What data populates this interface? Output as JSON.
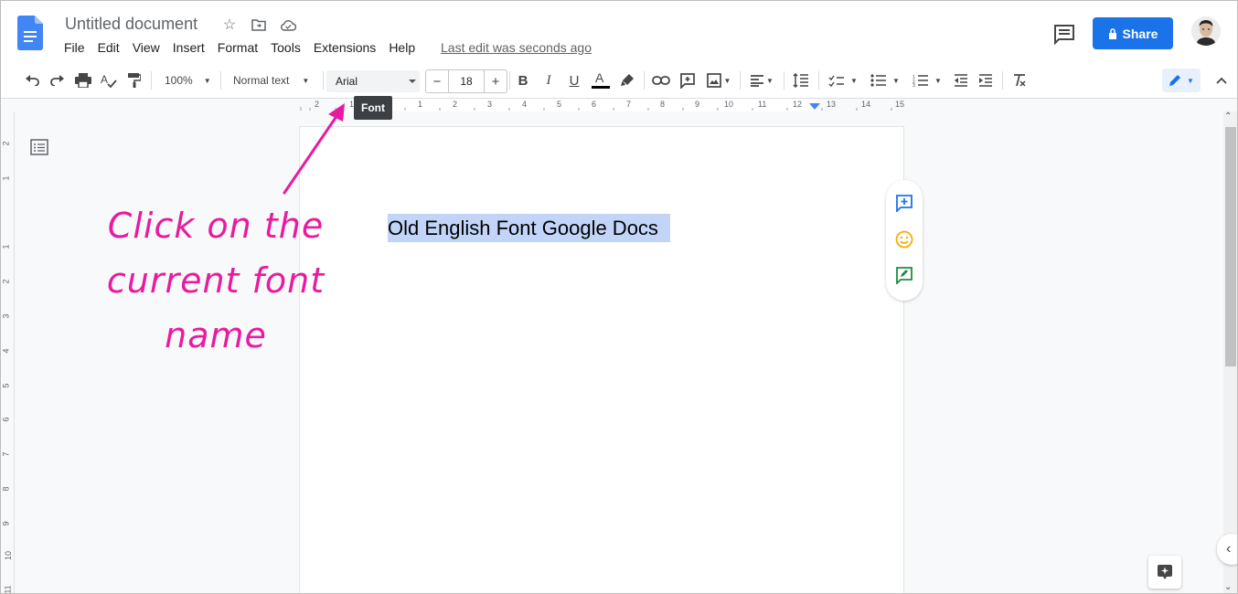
{
  "header": {
    "doc_title": "Untitled document",
    "menu": [
      "File",
      "Edit",
      "View",
      "Insert",
      "Format",
      "Tools",
      "Extensions",
      "Help"
    ],
    "last_edit": "Last edit was seconds ago",
    "share_label": "Share"
  },
  "toolbar": {
    "zoom": "100%",
    "style": "Normal text",
    "font": "Arial",
    "font_size": "18",
    "tooltip": "Font"
  },
  "ruler": {
    "h_labels": [
      "2",
      "1",
      "1",
      "2",
      "3",
      "4",
      "5",
      "6",
      "7",
      "8",
      "9",
      "10",
      "11",
      "12",
      "13",
      "14",
      "15"
    ],
    "v_labels": [
      "2",
      "1",
      "1",
      "2",
      "3",
      "4",
      "5",
      "6",
      "7",
      "8",
      "9",
      "10",
      "11"
    ]
  },
  "document": {
    "selected_text": "Old English Font Google Docs"
  },
  "annotation": {
    "line1": "Click on the",
    "line2": "current font name",
    "color": "#e81ba0"
  },
  "colors": {
    "accent": "#1a73e8",
    "selection": "#c2d5f8"
  }
}
